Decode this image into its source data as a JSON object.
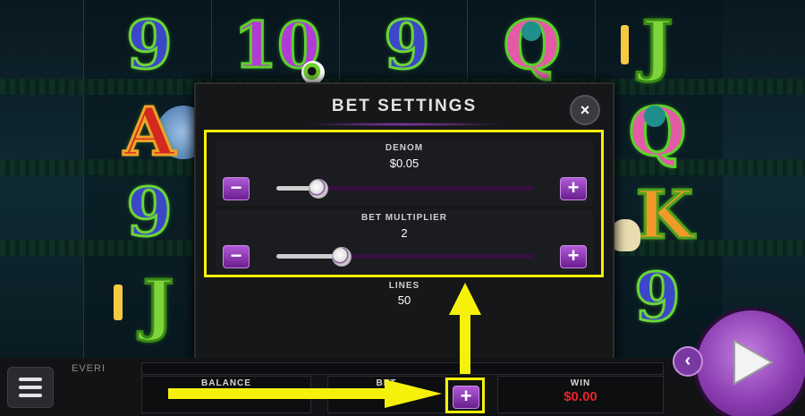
{
  "reels": [
    [
      "9",
      "A",
      "9",
      "J"
    ],
    [
      "10",
      "",
      "",
      ""
    ],
    [
      "9",
      "",
      "",
      ""
    ],
    [
      "Q",
      "",
      "",
      ""
    ],
    [
      "J",
      "Q",
      "K",
      "9"
    ]
  ],
  "colors": {
    "accent_purple": "#8a3cb0",
    "highlight_yellow": "#f5f10a",
    "win_red": "#e8222a"
  },
  "modal": {
    "title": "BET SETTINGS",
    "close_icon": "×",
    "denom": {
      "label": "DENOM",
      "value": "$0.05",
      "slider_fraction": 0.16
    },
    "bet_multiplier": {
      "label": "BET MULTIPLIER",
      "value": "2",
      "slider_fraction": 0.25
    },
    "lines": {
      "label": "LINES",
      "value": "50"
    },
    "minus_icon": "−",
    "plus_icon": "+"
  },
  "bottom_bar": {
    "logo": "EVERI",
    "balance_label": "BALANCE",
    "bet_label": "BET",
    "bet_plus_icon": "+",
    "win_label": "WIN",
    "win_value": "$0.00"
  },
  "icons": {
    "menu": "hamburger-icon",
    "spin": "play-icon",
    "prev": "chevron-left-icon"
  }
}
